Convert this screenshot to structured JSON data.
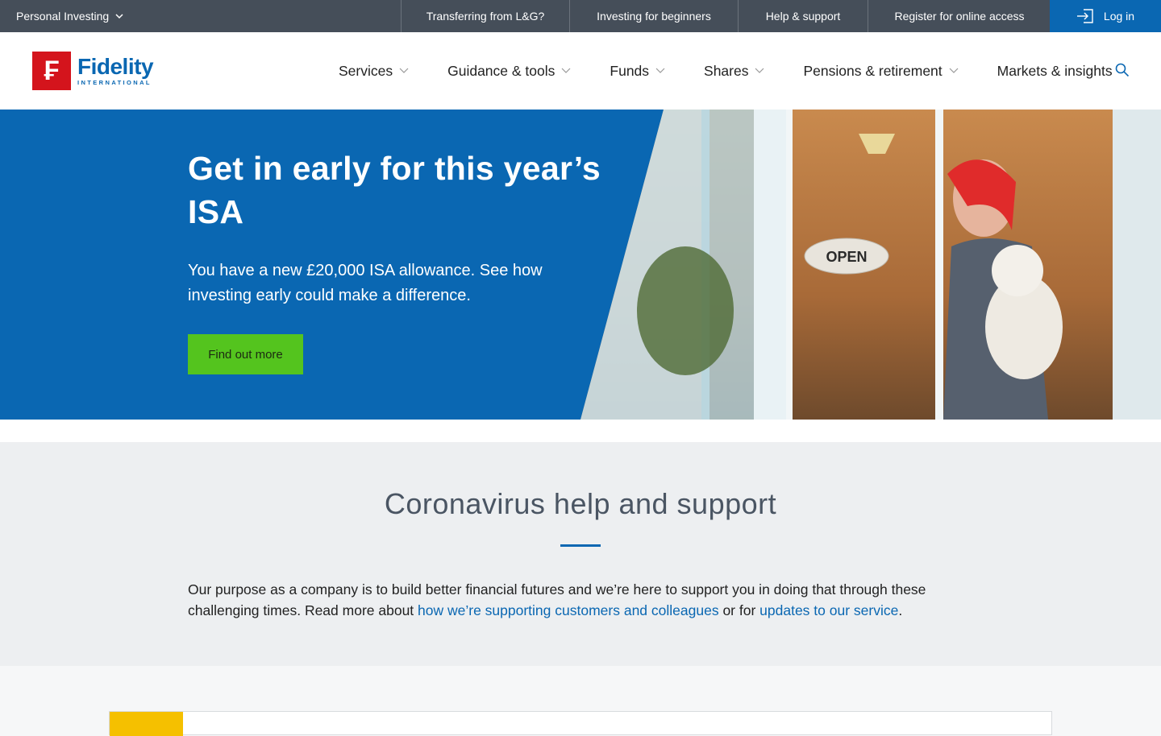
{
  "topbar": {
    "segment_label": "Personal Investing",
    "links": [
      {
        "label": "Transferring from L&G?"
      },
      {
        "label": "Investing for beginners"
      },
      {
        "label": "Help & support"
      },
      {
        "label": "Register for online access"
      }
    ],
    "login_label": "Log in",
    "login_icon": "login-icon"
  },
  "header": {
    "logo_name": "Fidelity",
    "logo_sub": "INTERNATIONAL",
    "nav": [
      {
        "label": "Services",
        "has_dropdown": true
      },
      {
        "label": "Guidance & tools",
        "has_dropdown": true
      },
      {
        "label": "Funds",
        "has_dropdown": true
      },
      {
        "label": "Shares",
        "has_dropdown": true
      },
      {
        "label": "Pensions & retirement",
        "has_dropdown": true
      },
      {
        "label": "Markets & insights",
        "has_dropdown": false
      }
    ],
    "search_icon": "search-icon"
  },
  "hero": {
    "title": "Get in early for this year’s ISA",
    "intro": "You have a new £20,000 ISA allowance. See how investing early could make a difference.",
    "cta_label": "Find out more",
    "sign_text": "OPEN",
    "background_color": "#0a67b2",
    "cta_color": "#54c41e"
  },
  "covid": {
    "title": "Coronavirus help and support",
    "body_prefix": "Our purpose as a company is to build better financial futures and we’re here to support you in doing that through these challenging times. Read more about ",
    "link1": "how we’re supporting customers and colleagues",
    "body_middle": " or for ",
    "link2": "updates to our service",
    "body_suffix": "."
  },
  "colors": {
    "topbar_bg": "#454e59",
    "brand_blue": "#0a67b2",
    "brand_red": "#d4141c",
    "section_grey": "#edeff1",
    "accent_yellow": "#f5c000"
  }
}
